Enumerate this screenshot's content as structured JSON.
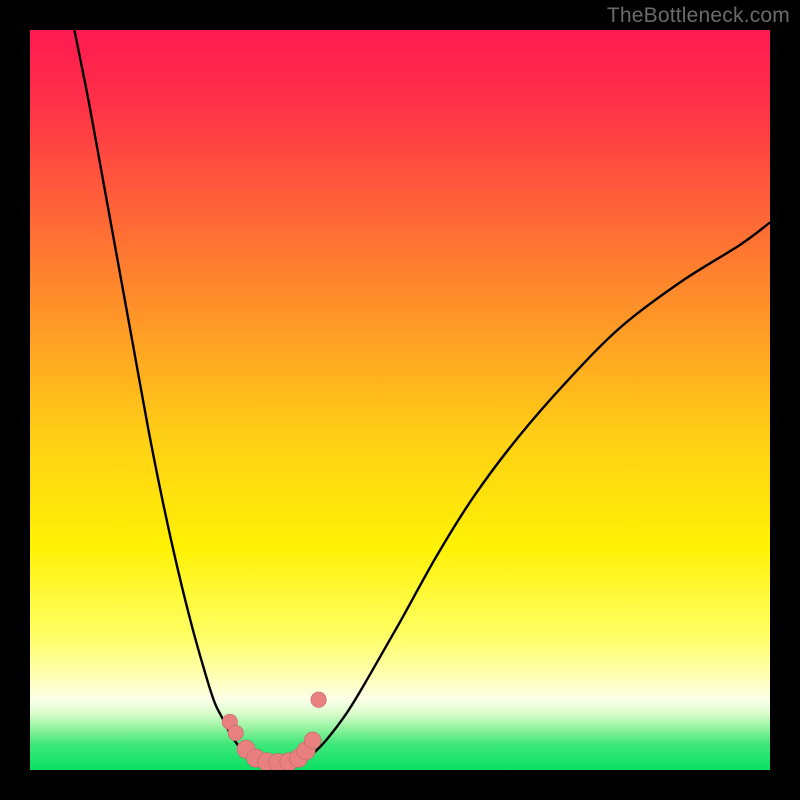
{
  "watermark": "TheBottleneck.com",
  "colors": {
    "frame": "#000000",
    "curve": "#000000",
    "marker_fill": "#e98080",
    "marker_stroke": "#c26767",
    "gradient_stops": [
      {
        "offset": 0.0,
        "color": "#ff1a51"
      },
      {
        "offset": 0.1,
        "color": "#ff3148"
      },
      {
        "offset": 0.25,
        "color": "#ff6637"
      },
      {
        "offset": 0.4,
        "color": "#ff9a26"
      },
      {
        "offset": 0.55,
        "color": "#ffcf15"
      },
      {
        "offset": 0.7,
        "color": "#fff205"
      },
      {
        "offset": 0.82,
        "color": "#ffff66"
      },
      {
        "offset": 0.88,
        "color": "#ffffc0"
      },
      {
        "offset": 0.905,
        "color": "#fbffe8"
      },
      {
        "offset": 0.925,
        "color": "#d6fbc9"
      },
      {
        "offset": 0.945,
        "color": "#8ef29c"
      },
      {
        "offset": 0.965,
        "color": "#3ee87a"
      },
      {
        "offset": 1.0,
        "color": "#0adf62"
      }
    ]
  },
  "chart_data": {
    "type": "line",
    "title": "",
    "xlabel": "",
    "ylabel": "",
    "xlim": [
      0,
      100
    ],
    "ylim": [
      0,
      100
    ],
    "series": [
      {
        "name": "left-branch",
        "x": [
          6,
          8,
          10,
          12,
          14,
          16,
          18,
          20,
          22,
          24,
          25,
          26,
          27,
          28,
          29,
          30
        ],
        "y": [
          100,
          90,
          79,
          68,
          57,
          46,
          36,
          27,
          19,
          12,
          9,
          7,
          5,
          3.5,
          2.3,
          1.5
        ]
      },
      {
        "name": "valley",
        "x": [
          30,
          31,
          32,
          33,
          34,
          35,
          36,
          37,
          38
        ],
        "y": [
          1.5,
          1.0,
          0.8,
          0.7,
          0.7,
          0.8,
          1.0,
          1.4,
          2.0
        ]
      },
      {
        "name": "right-branch",
        "x": [
          38,
          40,
          43,
          46,
          50,
          55,
          60,
          66,
          73,
          80,
          88,
          96,
          100
        ],
        "y": [
          2.0,
          4.0,
          8.0,
          13,
          20,
          29,
          37,
          45,
          53,
          60,
          66,
          71,
          74
        ]
      }
    ],
    "markers": {
      "name": "highlighted-points",
      "x": [
        27.0,
        27.8,
        29.2,
        30.5,
        32.0,
        33.5,
        35.0,
        36.3,
        37.3,
        38.2,
        39.0
      ],
      "y": [
        6.5,
        5.0,
        2.8,
        1.6,
        1.1,
        1.0,
        1.1,
        1.6,
        2.6,
        4.0,
        9.5
      ],
      "r": [
        1.1,
        1.1,
        1.3,
        1.3,
        1.3,
        1.3,
        1.3,
        1.3,
        1.3,
        1.2,
        1.1
      ]
    }
  }
}
